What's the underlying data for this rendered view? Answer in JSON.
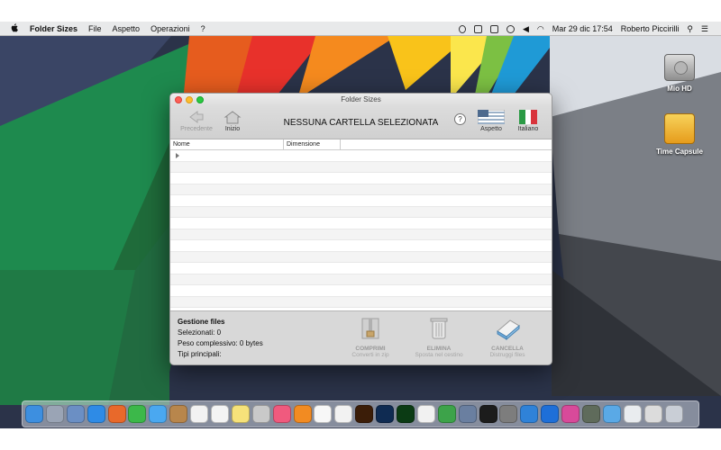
{
  "menubar": {
    "apple": "",
    "app_name": "Folder Sizes",
    "menus": [
      "File",
      "Aspetto",
      "Operazioni",
      "?"
    ],
    "clock": "Mar 29 dic  17:54",
    "user": "Roberto Piccirilli",
    "search_icon": "⚲",
    "list_icon": "☰"
  },
  "desktop": {
    "icons": [
      {
        "label": "Mio HD",
        "icon": "hard-disk-icon"
      },
      {
        "label": "Time Capsule",
        "icon": "time-capsule-icon"
      }
    ]
  },
  "window": {
    "title": "Folder Sizes",
    "toolbar": {
      "back_label": "Precedente",
      "home_label": "Inizio",
      "status": "NESSUNA CARTELLA SELEZIONATA",
      "help": "?",
      "appearance_label": "Aspetto",
      "language_label": "Italiano"
    },
    "table": {
      "columns": [
        "Nome",
        "Dimensione"
      ]
    },
    "files_panel": {
      "title": "Gestione files",
      "selected": "Selezionati: 0",
      "weight": "Peso complessivo: 0 bytes",
      "types": "Tipi principali:"
    },
    "actions": [
      {
        "label": "COMPRIMI",
        "sub": "Converti in zip"
      },
      {
        "label": "ELIMINA",
        "sub": "Sposta nel cestino"
      },
      {
        "label": "CANCELLA",
        "sub": "Distruggi files"
      }
    ]
  },
  "dock": {
    "items": [
      "finder",
      "launchpad",
      "preview",
      "safari",
      "firefox",
      "facetime",
      "messages",
      "notefile",
      "calendar",
      "reminders",
      "notes",
      "photo-booth",
      "itunes",
      "ibooks",
      "textedit",
      "photos",
      "illustrator",
      "photoshop",
      "dreamweaver",
      "pages",
      "numbers",
      "sequel",
      "terminal",
      "preferences",
      "xcode",
      "teamviewer",
      "siri",
      "camera",
      "downloads",
      "mail",
      "scanner",
      "trash"
    ]
  },
  "colors": {
    "dock_folder": "#5aa9e6",
    "window_bg": "#ececec"
  }
}
